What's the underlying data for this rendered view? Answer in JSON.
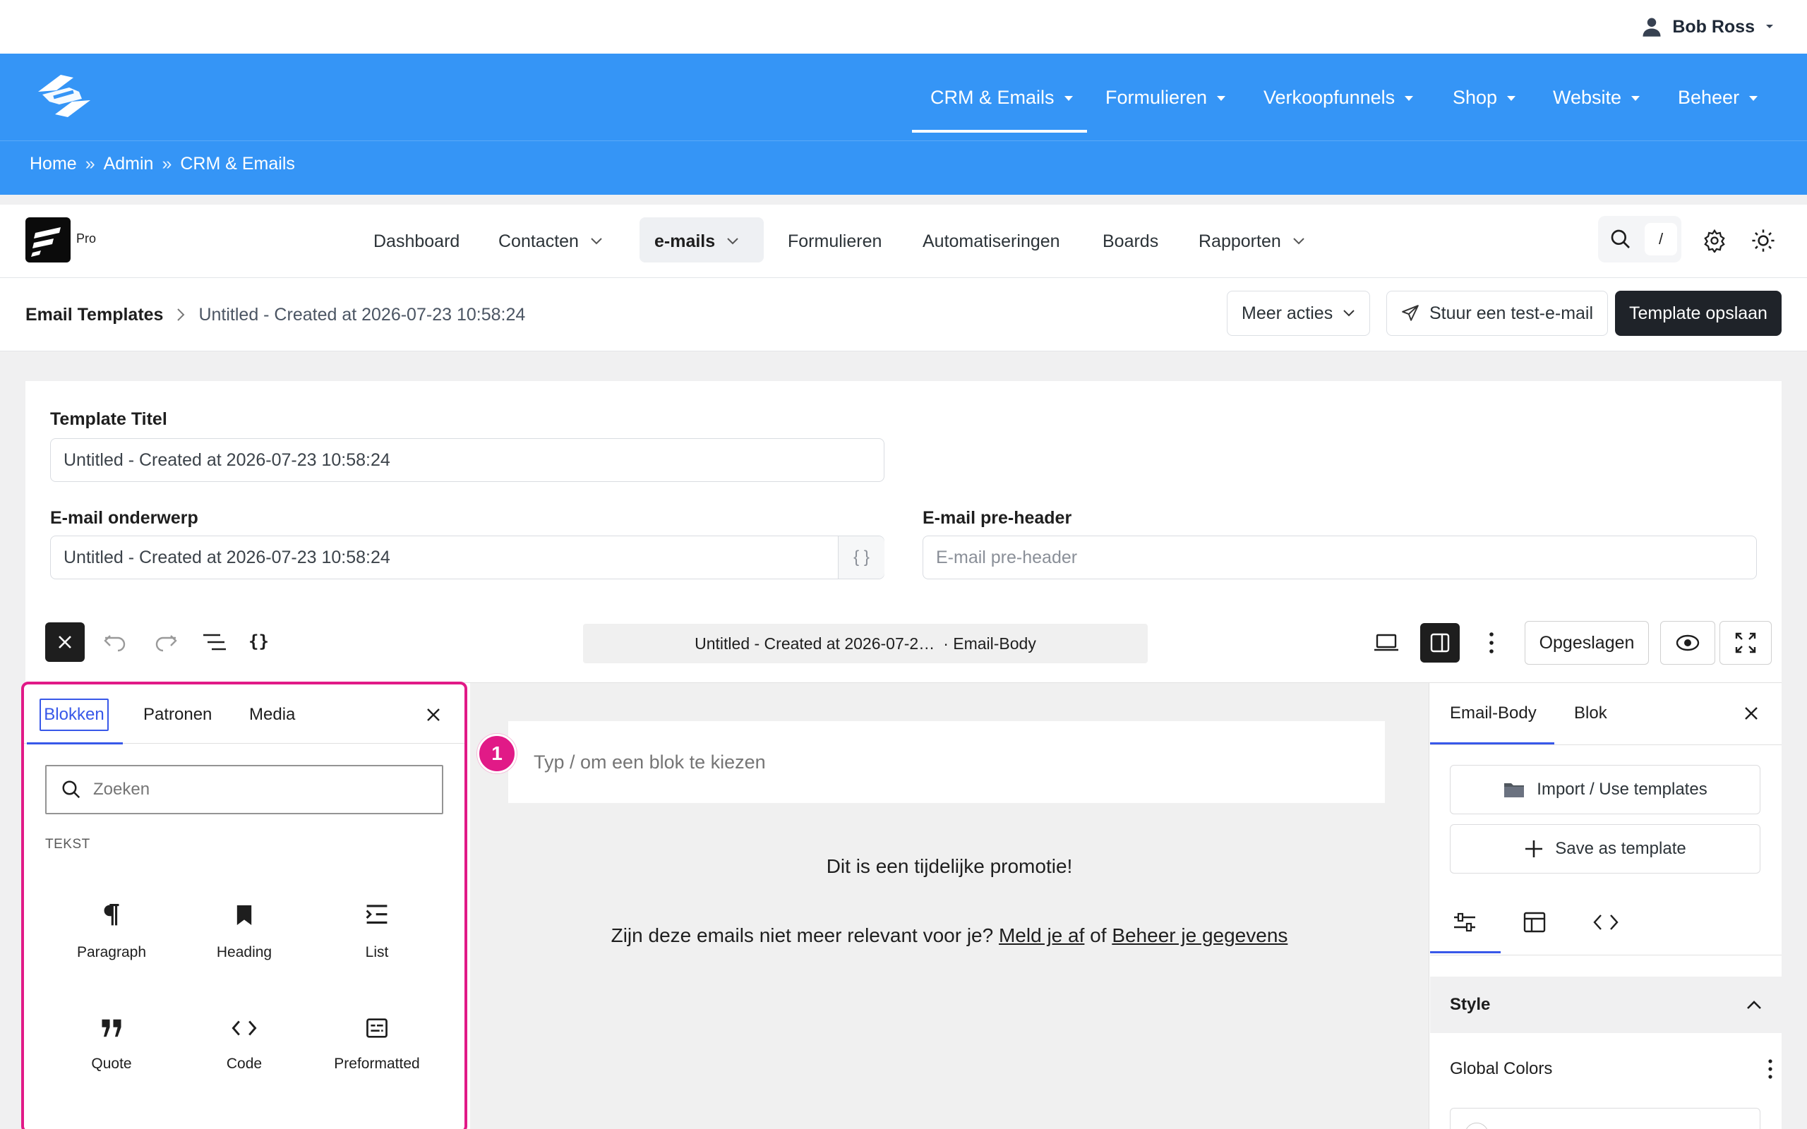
{
  "user": {
    "name": "Bob Ross"
  },
  "main_nav": {
    "items": [
      {
        "label": "CRM & Emails"
      },
      {
        "label": "Formulieren"
      },
      {
        "label": "Verkoopfunnels"
      },
      {
        "label": "Shop"
      },
      {
        "label": "Website"
      },
      {
        "label": "Beheer"
      }
    ],
    "active": "CRM & Emails"
  },
  "breadcrumb": {
    "items": [
      "Home",
      "Admin",
      "CRM & Emails"
    ],
    "separator": "»"
  },
  "app_nav": {
    "badge": "Pro",
    "items": [
      "Dashboard",
      "Contacten",
      "e-mails",
      "Formulieren",
      "Automatiseringen",
      "Boards",
      "Rapporten"
    ],
    "active": "e-mails",
    "search_shortcut": "/"
  },
  "title_bar": {
    "section": "Email Templates",
    "current": "Untitled - Created at 2026-07-23 10:58:24",
    "more_actions": "Meer acties",
    "send_test": "Stuur een test-e-mail",
    "save_template": "Template opslaan"
  },
  "form": {
    "title_label": "Template Titel",
    "title_value": "Untitled - Created at 2026-07-23 10:58:24",
    "subject_label": "E-mail onderwerp",
    "subject_value": "Untitled - Created at 2026-07-23 10:58:24",
    "subject_tags": "{ }",
    "preheader_label": "E-mail pre-header",
    "preheader_placeholder": "E-mail pre-header"
  },
  "editor": {
    "doc_title": "Untitled - Created at 2026-07-2…",
    "doc_type": "· Email-Body",
    "braces": "{}",
    "saved": "Opgeslagen"
  },
  "inserter": {
    "tabs": [
      "Blokken",
      "Patronen",
      "Media"
    ],
    "active_tab": "Blokken",
    "search_placeholder": "Zoeken",
    "category": "TEKST",
    "blocks": [
      {
        "label": "Paragraph",
        "icon": "paragraph-icon"
      },
      {
        "label": "Heading",
        "icon": "heading-icon"
      },
      {
        "label": "List",
        "icon": "list-icon"
      },
      {
        "label": "Quote",
        "icon": "quote-icon"
      },
      {
        "label": "Code",
        "icon": "code-icon"
      },
      {
        "label": "Preformatted",
        "icon": "preformatted-icon"
      }
    ]
  },
  "canvas": {
    "step": "1",
    "appender_placeholder": "Typ / om een blok te kiezen",
    "promo": "Dit is een tijdelijke promotie!",
    "footer_text": "Zijn deze emails niet meer relevant voor je?",
    "unsubscribe_link": "Meld je af",
    "footer_or": "of",
    "manage_link": "Beheer je gegevens"
  },
  "settings": {
    "tabs": [
      "Email-Body",
      "Blok"
    ],
    "active_tab": "Email-Body",
    "import_btn": "Import / Use templates",
    "save_as_btn": "Save as template",
    "style_heading": "Style",
    "global_colors": "Global Colors"
  },
  "colors": {
    "brand_blue": "#3595f6",
    "accent_pink": "#e11a87",
    "wp_blue": "#3858e9",
    "dark": "#1f2329"
  }
}
